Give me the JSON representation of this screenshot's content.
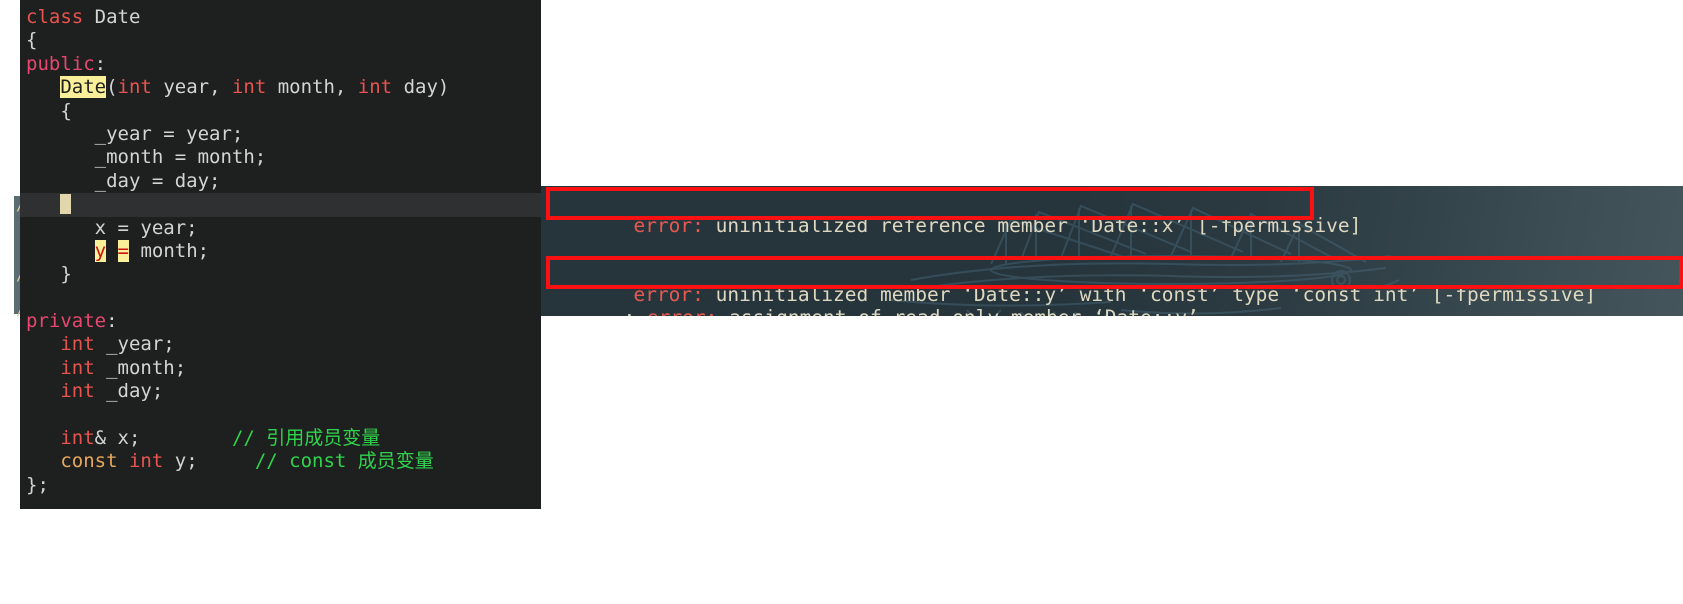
{
  "editor": {
    "name": "code-editor-panel",
    "background_color": "#1e1f1f",
    "cursor_line_color": "#2f3031",
    "highlight_color": "#fbf09a",
    "lines": [
      {
        "i": 0,
        "tokens": [
          {
            "t": "class ",
            "c": "kw"
          },
          {
            "t": "Date",
            "c": "plain"
          }
        ]
      },
      {
        "i": 1,
        "tokens": [
          {
            "t": "{",
            "c": "plain"
          }
        ]
      },
      {
        "i": 2,
        "tokens": [
          {
            "t": "public",
            "c": "acc"
          },
          {
            "t": ":",
            "c": "plain"
          }
        ]
      },
      {
        "i": 3,
        "tokens": [
          {
            "t": "   ",
            "c": "plain"
          },
          {
            "t": "Date",
            "c": "hl-name"
          },
          {
            "t": "(",
            "c": "plain"
          },
          {
            "t": "int",
            "c": "kw"
          },
          {
            "t": " year, ",
            "c": "plain"
          },
          {
            "t": "int",
            "c": "kw"
          },
          {
            "t": " month, ",
            "c": "plain"
          },
          {
            "t": "int",
            "c": "kw"
          },
          {
            "t": " day)",
            "c": "plain"
          }
        ]
      },
      {
        "i": 4,
        "tokens": [
          {
            "t": "   {",
            "c": "plain"
          }
        ]
      },
      {
        "i": 5,
        "tokens": [
          {
            "t": "      _year = year;",
            "c": "plain"
          }
        ]
      },
      {
        "i": 6,
        "tokens": [
          {
            "t": "      _month = month;",
            "c": "plain"
          }
        ]
      },
      {
        "i": 7,
        "tokens": [
          {
            "t": "      _day = day;",
            "c": "plain"
          }
        ]
      },
      {
        "i": 8,
        "cursor": true,
        "tokens": [
          {
            "t": "   ",
            "c": "plain"
          }
        ]
      },
      {
        "i": 9,
        "tokens": [
          {
            "t": "      x = year;",
            "c": "plain"
          }
        ]
      },
      {
        "i": 10,
        "tokens": [
          {
            "t": "      ",
            "c": "plain"
          },
          {
            "t": "y",
            "c": "hl-y"
          },
          {
            "t": " ",
            "c": "plain"
          },
          {
            "t": "=",
            "c": "hl-eq"
          },
          {
            "t": " month;",
            "c": "plain"
          }
        ]
      },
      {
        "i": 11,
        "tokens": [
          {
            "t": "   }",
            "c": "plain"
          }
        ]
      },
      {
        "i": 12,
        "tokens": [
          {
            "t": "",
            "c": "plain"
          }
        ]
      },
      {
        "i": 13,
        "tokens": [
          {
            "t": "private",
            "c": "acc"
          },
          {
            "t": ":",
            "c": "plain"
          }
        ]
      },
      {
        "i": 14,
        "tokens": [
          {
            "t": "   ",
            "c": "plain"
          },
          {
            "t": "int",
            "c": "kw"
          },
          {
            "t": " _year;",
            "c": "plain"
          }
        ]
      },
      {
        "i": 15,
        "tokens": [
          {
            "t": "   ",
            "c": "plain"
          },
          {
            "t": "int",
            "c": "kw"
          },
          {
            "t": " _month;",
            "c": "plain"
          }
        ]
      },
      {
        "i": 16,
        "tokens": [
          {
            "t": "   ",
            "c": "plain"
          },
          {
            "t": "int",
            "c": "kw"
          },
          {
            "t": " _day;",
            "c": "plain"
          }
        ]
      },
      {
        "i": 17,
        "tokens": [
          {
            "t": "",
            "c": "plain"
          }
        ]
      },
      {
        "i": 18,
        "tokens": [
          {
            "t": "   ",
            "c": "plain"
          },
          {
            "t": "int",
            "c": "kw"
          },
          {
            "t": "& x;",
            "c": "plain"
          },
          {
            "t": "        ",
            "c": "plain"
          },
          {
            "t": "// 引用成员变量",
            "c": "cmt"
          }
        ]
      },
      {
        "i": 19,
        "tokens": [
          {
            "t": "   ",
            "c": "plain"
          },
          {
            "t": "const",
            "c": "constkw"
          },
          {
            "t": " ",
            "c": "plain"
          },
          {
            "t": "int",
            "c": "kw"
          },
          {
            "t": " y;",
            "c": "plain"
          },
          {
            "t": "     ",
            "c": "plain"
          },
          {
            "t": "// const 成员变量",
            "c": "cmt"
          }
        ]
      },
      {
        "i": 20,
        "tokens": [
          {
            "t": "};",
            "c": "plain"
          }
        ]
      }
    ]
  },
  "terminal": {
    "name": "compiler-output-terminal",
    "error_color": "#e8584f",
    "text_color": "#ded8c0",
    "lines": [
      {
        "prefix": "",
        "label": "error:",
        "message": " uninitialized reference member ‘Date::x’ [-fpermissive]"
      },
      {
        "prefix": "",
        "label": "error:",
        "message": " uninitialized member ‘Date::y’ with ‘const’ type ‘const int’ [-fpermissive]"
      },
      {
        "prefix": ": ",
        "label": "error:",
        "message": " assignment of read-only member ‘Date::y’"
      }
    ]
  },
  "annotations": {
    "color": "#fb1111",
    "boxes": [
      {
        "target": "error-line-1"
      },
      {
        "target": "error-line-2"
      }
    ]
  },
  "behind": {
    "glyph": "/",
    "strip_color": "#5a6b72"
  }
}
